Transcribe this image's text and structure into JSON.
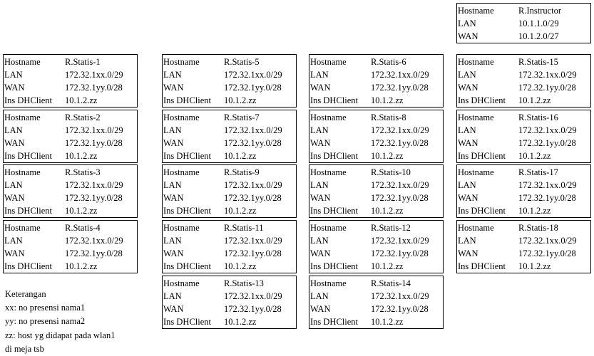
{
  "labels": {
    "hostname": "Hostname",
    "lan": "LAN",
    "wan": "WAN",
    "dhclient": "Ins DHClient"
  },
  "instructor": {
    "hostname": "R.Instructor",
    "lan": "10.1.1.0/29",
    "wan": "10.1.2.0/27"
  },
  "routers": [
    {
      "hostname": "R.Statis-1",
      "lan": "172.32.1xx.0/29",
      "wan": "172.32.1yy.0/28",
      "dhclient": "10.1.2.zz"
    },
    {
      "hostname": "R.Statis-2",
      "lan": "172.32.1xx.0/29",
      "wan": "172.32.1yy.0/28",
      "dhclient": "10.1.2.zz"
    },
    {
      "hostname": "R.Statis-3",
      "lan": "172.32.1xx.0/29",
      "wan": "172.32.1yy.0/28",
      "dhclient": "10.1.2.zz"
    },
    {
      "hostname": "R.Statis-4",
      "lan": "172.32.1xx.0/29",
      "wan": "172.32.1yy.0/28",
      "dhclient": "10.1.2.zz"
    },
    {
      "hostname": "R.Statis-5",
      "lan": "172.32.1xx.0/29",
      "wan": "172.32.1yy.0/28",
      "dhclient": "10.1.2.zz"
    },
    {
      "hostname": "R.Statis-7",
      "lan": "172.32.1xx.0/29",
      "wan": "172.32.1yy.0/28",
      "dhclient": "10.1.2.zz"
    },
    {
      "hostname": "R.Statis-9",
      "lan": "172.32.1xx.0/29",
      "wan": "172.32.1yy.0/28",
      "dhclient": "10.1.2.zz"
    },
    {
      "hostname": "R.Statis-11",
      "lan": "172.32.1xx.0/29",
      "wan": "172.32.1yy.0/28",
      "dhclient": "10.1.2.zz"
    },
    {
      "hostname": "R.Statis-13",
      "lan": "172.32.1xx.0/29",
      "wan": "172.32.1yy.0/28",
      "dhclient": "10.1.2.zz"
    },
    {
      "hostname": "R.Statis-6",
      "lan": "172.32.1xx.0/29",
      "wan": "172.32.1yy.0/28",
      "dhclient": "10.1.2.zz"
    },
    {
      "hostname": "R.Statis-8",
      "lan": "172.32.1xx.0/29",
      "wan": "172.32.1yy.0/28",
      "dhclient": "10.1.2.zz"
    },
    {
      "hostname": "R.Statis-10",
      "lan": "172.32.1xx.0/29",
      "wan": "172.32.1yy.0/28",
      "dhclient": "10.1.2.zz"
    },
    {
      "hostname": "R.Statis-12",
      "lan": "172.32.1xx.0/29",
      "wan": "172.32.1yy.0/28",
      "dhclient": "10.1.2.zz"
    },
    {
      "hostname": "R.Statis-14",
      "lan": "172.32.1xx.0/29",
      "wan": "172.32.1yy.0/28",
      "dhclient": "10.1.2.zz"
    },
    {
      "hostname": "R.Statis-15",
      "lan": "172.32.1xx.0/29",
      "wan": "172.32.1yy.0/28",
      "dhclient": "10.1.2.zz"
    },
    {
      "hostname": "R.Statis-16",
      "lan": "172.32.1xx.0/29",
      "wan": "172.32.1yy.0/28",
      "dhclient": "10.1.2.zz"
    },
    {
      "hostname": "R.Statis-17",
      "lan": "172.32.1xx.0/29",
      "wan": "172.32.1yy.0/28",
      "dhclient": "10.1.2.zz"
    },
    {
      "hostname": "R.Statis-18",
      "lan": "172.32.1xx.0/29",
      "wan": "172.32.1yy.0/28",
      "dhclient": "10.1.2.zz"
    }
  ],
  "notes": {
    "title": "Keterangan",
    "lines": [
      "xx: no presensi nama1",
      "yy: no presensi nama2",
      "zz: host yg didapat pada wlan1",
      "di meja tsb"
    ]
  }
}
